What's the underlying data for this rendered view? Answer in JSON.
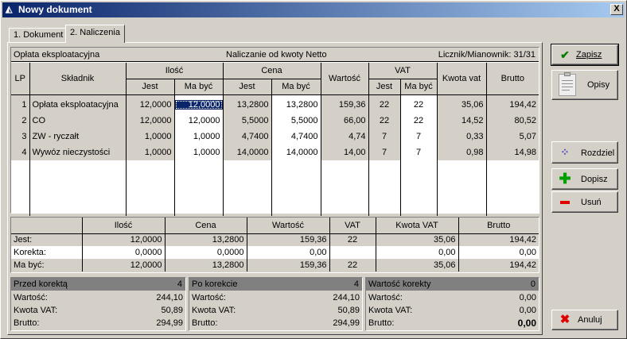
{
  "window": {
    "title": "Nowy dokument",
    "close_label": "X"
  },
  "tabs": [
    {
      "label": "1. Dokument"
    },
    {
      "label": "2. Naliczenia"
    }
  ],
  "grid": {
    "header_left": "Opłata eksploatacyjna",
    "header_center": "Naliczanie od kwoty Netto",
    "header_right": "Licznik/Mianownik: 31/31",
    "columns": {
      "lp": "LP",
      "skladnik": "Składnik",
      "ilosc": "Ilość",
      "cena": "Cena",
      "wartosc": "Wartość",
      "vat": "VAT",
      "kwota_vat": "Kwota vat",
      "brutto": "Brutto",
      "jest": "Jest",
      "ma_byc": "Ma być"
    },
    "rows": [
      {
        "lp": "1",
        "name": "Opłata eksploatacyjna",
        "ilosc_jest": "12,0000",
        "ilosc_ma": "12,0000",
        "cena_jest": "13,2800",
        "cena_ma": "13,2800",
        "wartosc": "159,36",
        "vat_jest": "22",
        "vat_ma": "22",
        "kwota_vat": "35,06",
        "brutto": "194,42"
      },
      {
        "lp": "2",
        "name": "CO",
        "ilosc_jest": "12,0000",
        "ilosc_ma": "12,0000",
        "cena_jest": "5,5000",
        "cena_ma": "5,5000",
        "wartosc": "66,00",
        "vat_jest": "22",
        "vat_ma": "22",
        "kwota_vat": "14,52",
        "brutto": "80,52"
      },
      {
        "lp": "3",
        "name": "ZW - ryczałt",
        "ilosc_jest": "1,0000",
        "ilosc_ma": "1,0000",
        "cena_jest": "4,7400",
        "cena_ma": "4,7400",
        "wartosc": "4,74",
        "vat_jest": "7",
        "vat_ma": "7",
        "kwota_vat": "0,33",
        "brutto": "5,07"
      },
      {
        "lp": "4",
        "name": "Wywóz nieczystości",
        "ilosc_jest": "1,0000",
        "ilosc_ma": "1,0000",
        "cena_jest": "14,0000",
        "cena_ma": "14,0000",
        "wartosc": "14,00",
        "vat_jest": "7",
        "vat_ma": "7",
        "kwota_vat": "0,98",
        "brutto": "14,98"
      }
    ]
  },
  "summary": {
    "columns": [
      "Ilość",
      "Cena",
      "Wartość",
      "VAT",
      "Kwota VAT",
      "Brutto"
    ],
    "rows": [
      {
        "label": "Jest:",
        "values": [
          "12,0000",
          "13,2800",
          "159,36",
          "22",
          "35,06",
          "194,42"
        ]
      },
      {
        "label": "Korekta:",
        "values": [
          "0,0000",
          "0,0000",
          "0,00",
          "",
          "0,00",
          "0,00"
        ]
      },
      {
        "label": "Ma być:",
        "values": [
          "12,0000",
          "13,2800",
          "159,36",
          "22",
          "35,06",
          "194,42"
        ]
      }
    ]
  },
  "panels": [
    {
      "title": "Przed korektą",
      "count": "4",
      "rows": [
        {
          "label": "Wartość:",
          "value": "244,10"
        },
        {
          "label": "Kwota VAT:",
          "value": "50,89"
        },
        {
          "label": "Brutto:",
          "value": "294,99"
        }
      ]
    },
    {
      "title": "Po korekcie",
      "count": "4",
      "rows": [
        {
          "label": "Wartość:",
          "value": "244,10"
        },
        {
          "label": "Kwota VAT:",
          "value": "50,89"
        },
        {
          "label": "Brutto:",
          "value": "294,99"
        }
      ]
    },
    {
      "title": "Wartość korekty",
      "count": "0",
      "rows": [
        {
          "label": "Wartość:",
          "value": "0,00"
        },
        {
          "label": "Kwota VAT:",
          "value": "0,00"
        },
        {
          "label": "Brutto:",
          "value": "0,00"
        }
      ]
    }
  ],
  "buttons": {
    "zapisz": "Zapisz",
    "opisy": "Opisy",
    "rozdziel": "Rozdziel",
    "dopisz": "Dopisz",
    "usun": "Usuń",
    "anuluj": "Anuluj"
  },
  "icons": {
    "zapisz": "check-icon",
    "opisy": "clipboard-icon",
    "rozdziel": "split-icon",
    "dopisz": "plus-icon",
    "usun": "minus-icon",
    "anuluj": "x-icon"
  },
  "colors": {
    "titlebar": "#0a246a",
    "selected_cell": "#0a246a",
    "check": "#008000",
    "plus": "#00a000",
    "minus": "#e00000",
    "x": "#e00000",
    "panel_header": "#808080"
  }
}
